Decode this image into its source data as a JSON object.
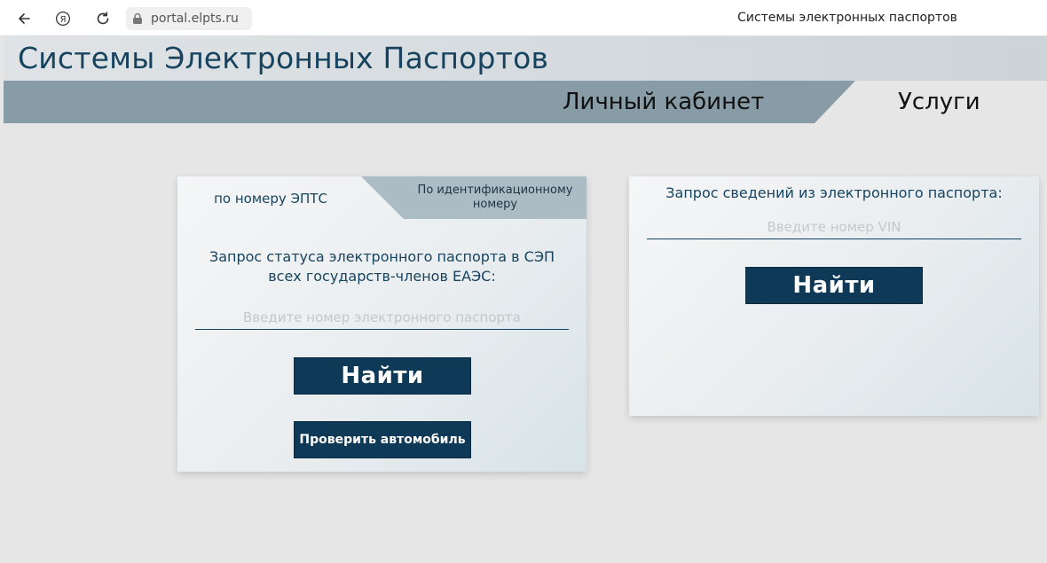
{
  "browser": {
    "url": "portal.elpts.ru",
    "tab_title": "Системы электронных паспортов"
  },
  "site": {
    "title": "Системы Электронных Паспортов",
    "nav": {
      "cabinet": "Личный кабинет",
      "services": "Услуги"
    }
  },
  "left_card": {
    "tabs": {
      "by_number": "по номеру ЭПТС",
      "by_id": "По идентификационному номеру"
    },
    "request_line1": "Запрос статуса электронного паспорта в СЭП",
    "request_line2": "всех государств-членов ЕАЭС:",
    "input_placeholder": "Введите номер электронного паспорта",
    "find_label": "Найти",
    "check_label": "Проверить автомобиль"
  },
  "right_card": {
    "request": "Запрос сведений из электронного паспорта:",
    "input_placeholder": "Введите номер VIN",
    "find_label": "Найти"
  },
  "colors": {
    "brand_dark": "#0f3a57",
    "title_text": "#17435f",
    "nav_bar": "#879ca6",
    "inactive_tab": "#acbcc5",
    "page_bg": "#e6e6e6"
  }
}
